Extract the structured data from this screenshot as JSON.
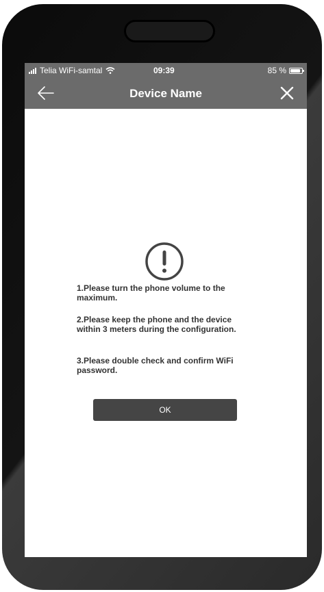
{
  "status_bar": {
    "carrier": "Telia WiFi-samtal",
    "time": "09:39",
    "battery_percent": "85 %",
    "battery_level": 0.85
  },
  "nav_bar": {
    "title": "Device Name",
    "back_icon": "arrow-left-icon",
    "close_icon": "close-icon"
  },
  "dialog": {
    "icon": "exclamation-circle-icon",
    "messages": [
      "1.Please turn the phone volume to the maximum.",
      "2.Please keep the phone and the device within 3 meters during the configuration.",
      "3.Please double check and confirm WiFi password."
    ],
    "ok_label": "OK"
  },
  "colors": {
    "header_bg": "#6b6b6b",
    "button_bg": "#454545",
    "text": "#333333"
  }
}
